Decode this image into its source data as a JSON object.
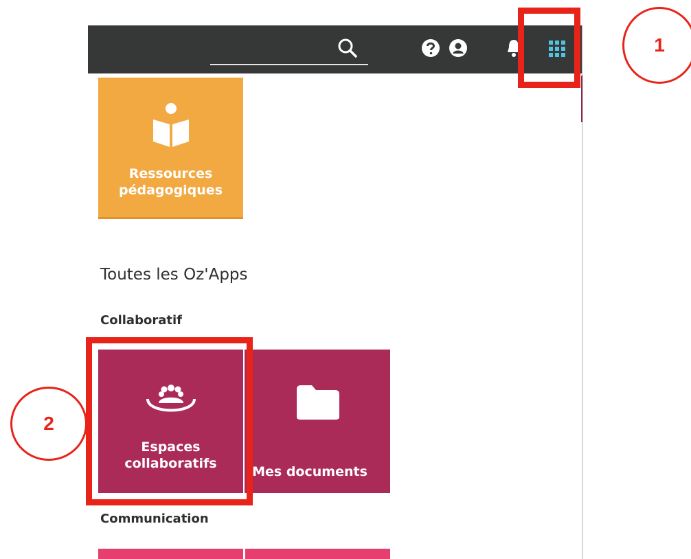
{
  "header": {
    "icons": [
      "search-icon",
      "help-icon",
      "account-icon",
      "notifications-icon",
      "apps-grid-icon"
    ]
  },
  "featured_tile": {
    "label": "Ressources\npédagogiques",
    "icon": "reading-person-icon",
    "color": "#f2a942"
  },
  "section_title": "Toutes les Oz'Apps",
  "categories": [
    {
      "name": "Collaboratif",
      "tiles": [
        {
          "label": "Espaces\ncollaboratifs",
          "icon": "group-icon"
        },
        {
          "label": "Mes documents",
          "icon": "folder-icon"
        }
      ]
    },
    {
      "name": "Communication",
      "tiles": []
    }
  ],
  "callouts": [
    "1",
    "2"
  ],
  "colors": {
    "header_bg": "#363838",
    "collab_tile": "#ab2b58",
    "communication_tile": "#e63e6e",
    "highlight": "#e8231a",
    "grid_icon": "#4fc3e0"
  }
}
